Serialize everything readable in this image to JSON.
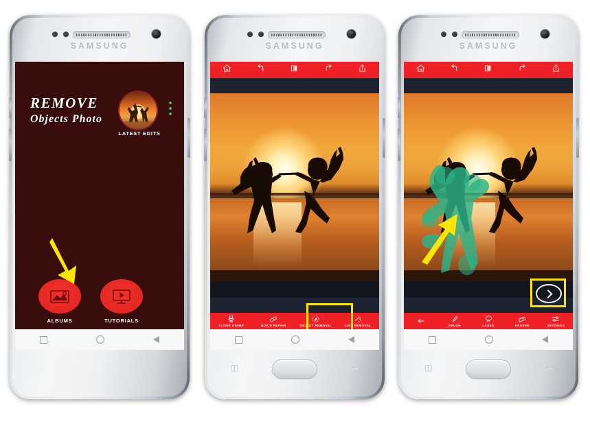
{
  "app": {
    "name": "Remove Objects Photo",
    "brand": "SAMSUNG",
    "accent_red": "#ef2026",
    "dark_maroon": "#3a0d0d",
    "highlight_yellow": "#ffe600",
    "mask_green": "#2bb58a",
    "navy_band": "#1d2330"
  },
  "phones": [
    {
      "id": "phone-1",
      "caption": "home-screen",
      "brand": "SAMSUNG",
      "screen": {
        "title_line1": "REMOVE",
        "title_line2": "Objects Photo",
        "latest_edits_label": "LATEST EDITS",
        "overflow_menu": "three-dot-menu",
        "buttons": [
          {
            "label": "ALBUMS",
            "icon": "photo-album-icon"
          },
          {
            "label": "TUTORIALS",
            "icon": "video-monitor-icon"
          }
        ],
        "annotation": {
          "type": "arrow",
          "color": "#ffe600",
          "points_to": "ALBUMS"
        }
      },
      "navbar": {
        "type": "software",
        "keys": [
          "recents-square",
          "home-circle",
          "back-triangle"
        ]
      }
    },
    {
      "id": "phone-2",
      "caption": "object-removal-tool-selection",
      "brand": "SAMSUNG",
      "screen": {
        "top_toolbar": [
          {
            "label": "",
            "icon": "home-icon"
          },
          {
            "label": "",
            "icon": "undo-icon"
          },
          {
            "label": "",
            "icon": "compare-split-icon"
          },
          {
            "label": "",
            "icon": "redo-icon"
          },
          {
            "label": "",
            "icon": "share-icon"
          }
        ],
        "photo_alt": "Two people silhouetted jumping at sunset over water",
        "bottom_toolbar": [
          {
            "label": "CLONE STAMP",
            "icon": "stamp-icon",
            "selected": false
          },
          {
            "label": "QUICK REPAIR",
            "icon": "bandage-icon",
            "selected": false
          },
          {
            "label": "OBJECT REMOVAL",
            "icon": "object-removal-icon",
            "selected": true
          },
          {
            "label": "LINE REMOVAL",
            "icon": "line-removal-icon",
            "selected": false
          }
        ],
        "annotation": {
          "type": "highlight-box",
          "color": "#ffe600",
          "targets": "OBJECT REMOVAL"
        }
      },
      "navbar": {
        "type": "software+physical",
        "keys": [
          "recents-square",
          "home-circle",
          "back-triangle"
        ],
        "physical": [
          "recents-icon",
          "home-button",
          "back-icon"
        ]
      }
    },
    {
      "id": "phone-3",
      "caption": "object-masked-with-brush",
      "brand": "SAMSUNG",
      "screen": {
        "top_toolbar": [
          {
            "label": "",
            "icon": "home-icon"
          },
          {
            "label": "",
            "icon": "undo-icon"
          },
          {
            "label": "",
            "icon": "compare-split-icon"
          },
          {
            "label": "",
            "icon": "redo-icon"
          },
          {
            "label": "",
            "icon": "share-icon"
          }
        ],
        "photo_alt": "Sunset silhouettes with left figure painted over in green selection mask",
        "mask_note": "green-selection-mask",
        "next_button": {
          "icon": "chevron-right-circle-icon",
          "label": ""
        },
        "bottom_toolbar": [
          {
            "label": "",
            "icon": "back-arrow-icon",
            "selected": false
          },
          {
            "label": "BRUSH",
            "icon": "brush-icon",
            "selected": false
          },
          {
            "label": "LASSO",
            "icon": "lasso-icon",
            "selected": false
          },
          {
            "label": "ERASER",
            "icon": "eraser-icon",
            "selected": false
          },
          {
            "label": "SETTINGS",
            "icon": "settings-sliders-icon",
            "selected": false
          }
        ],
        "annotations": [
          {
            "type": "arrow",
            "color": "#ffe600",
            "points_to": "green-selection-mask"
          },
          {
            "type": "arrow",
            "color": "#ffe600",
            "points_to": "ERASER"
          },
          {
            "type": "highlight-box",
            "color": "#ffe600",
            "targets": "next-button"
          }
        ]
      },
      "navbar": {
        "type": "software+physical",
        "keys": [
          "recents-square",
          "home-circle",
          "back-triangle"
        ],
        "physical": [
          "recents-icon",
          "home-button",
          "back-icon"
        ]
      }
    }
  ]
}
